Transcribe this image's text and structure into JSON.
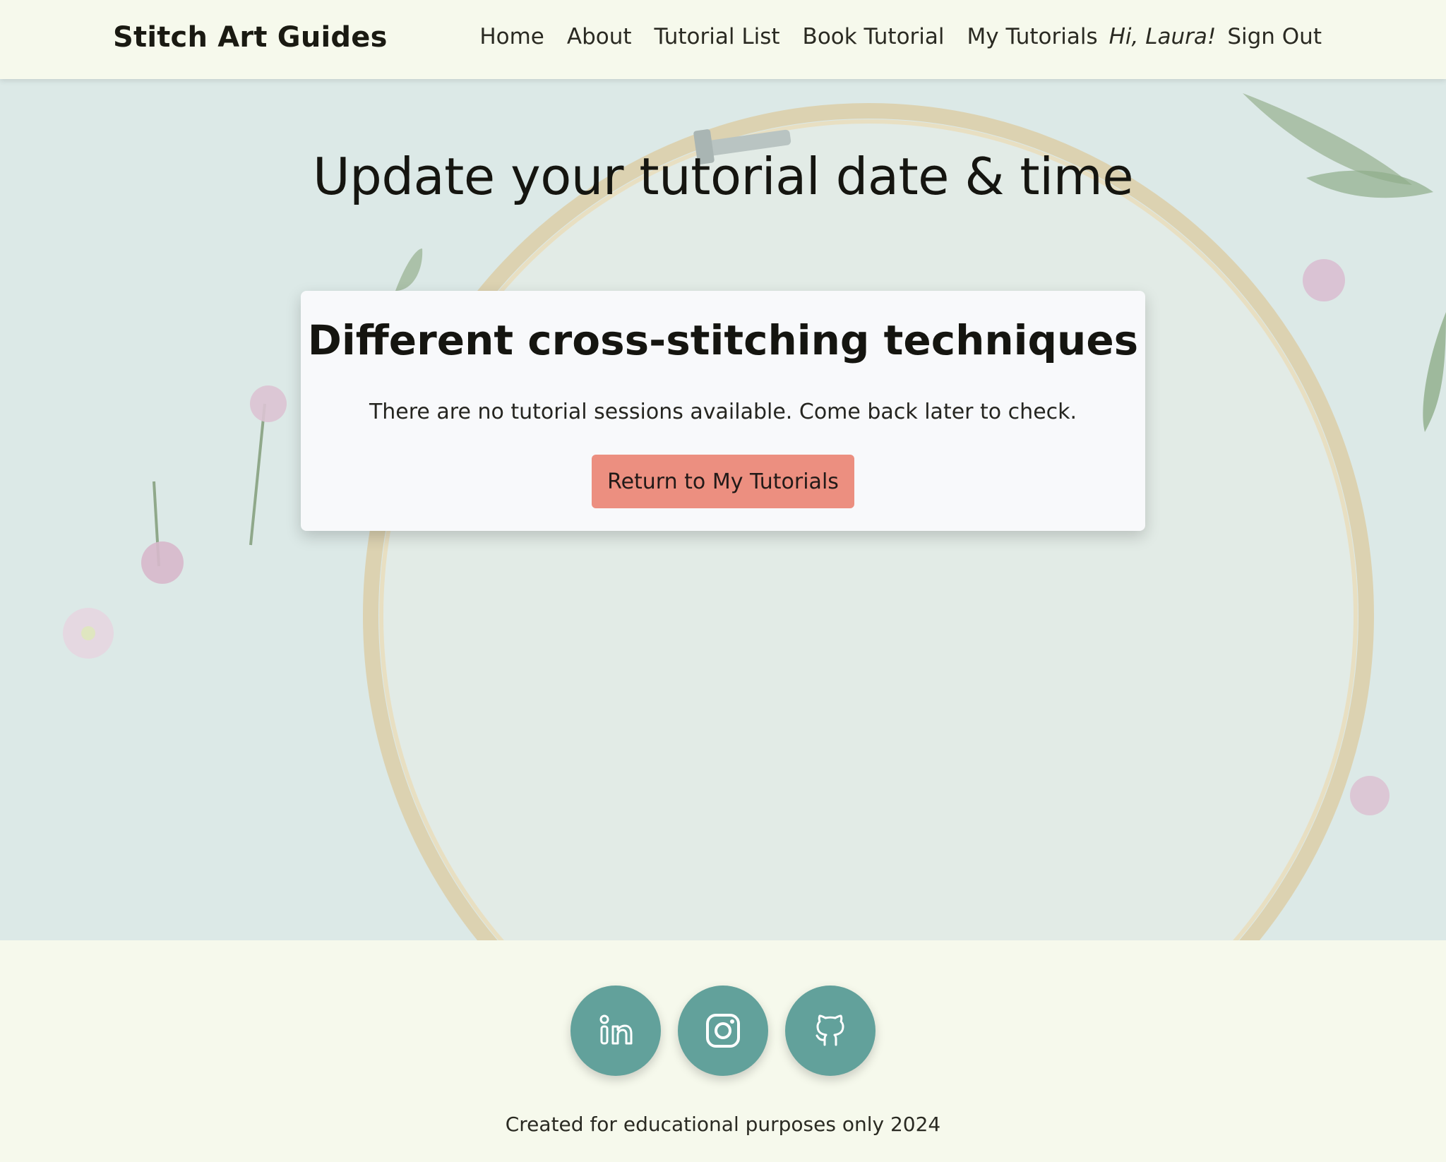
{
  "navbar": {
    "brand": "Stitch Art Guides",
    "links": [
      "Home",
      "About",
      "Tutorial List",
      "Book Tutorial",
      "My Tutorials"
    ],
    "greeting": "Hi, Laura!",
    "signout": "Sign Out"
  },
  "main": {
    "title": "Update your tutorial date & time",
    "card": {
      "title": "Different cross-stitching techniques",
      "message": "There are no tutorial sessions available. Come back later to check.",
      "button_label": "Return to My Tutorials"
    }
  },
  "footer": {
    "social": [
      {
        "icon": "linkedin-icon"
      },
      {
        "icon": "instagram-icon"
      },
      {
        "icon": "github-icon"
      }
    ],
    "text": "Created for educational purposes only 2024"
  },
  "colors": {
    "background": "#f6f9ec",
    "hero_bg": "#dbe8e6",
    "button_accent": "#ec8f80",
    "social_icon_bg": "#62a19b",
    "card_bg": "#f8f9fb"
  }
}
